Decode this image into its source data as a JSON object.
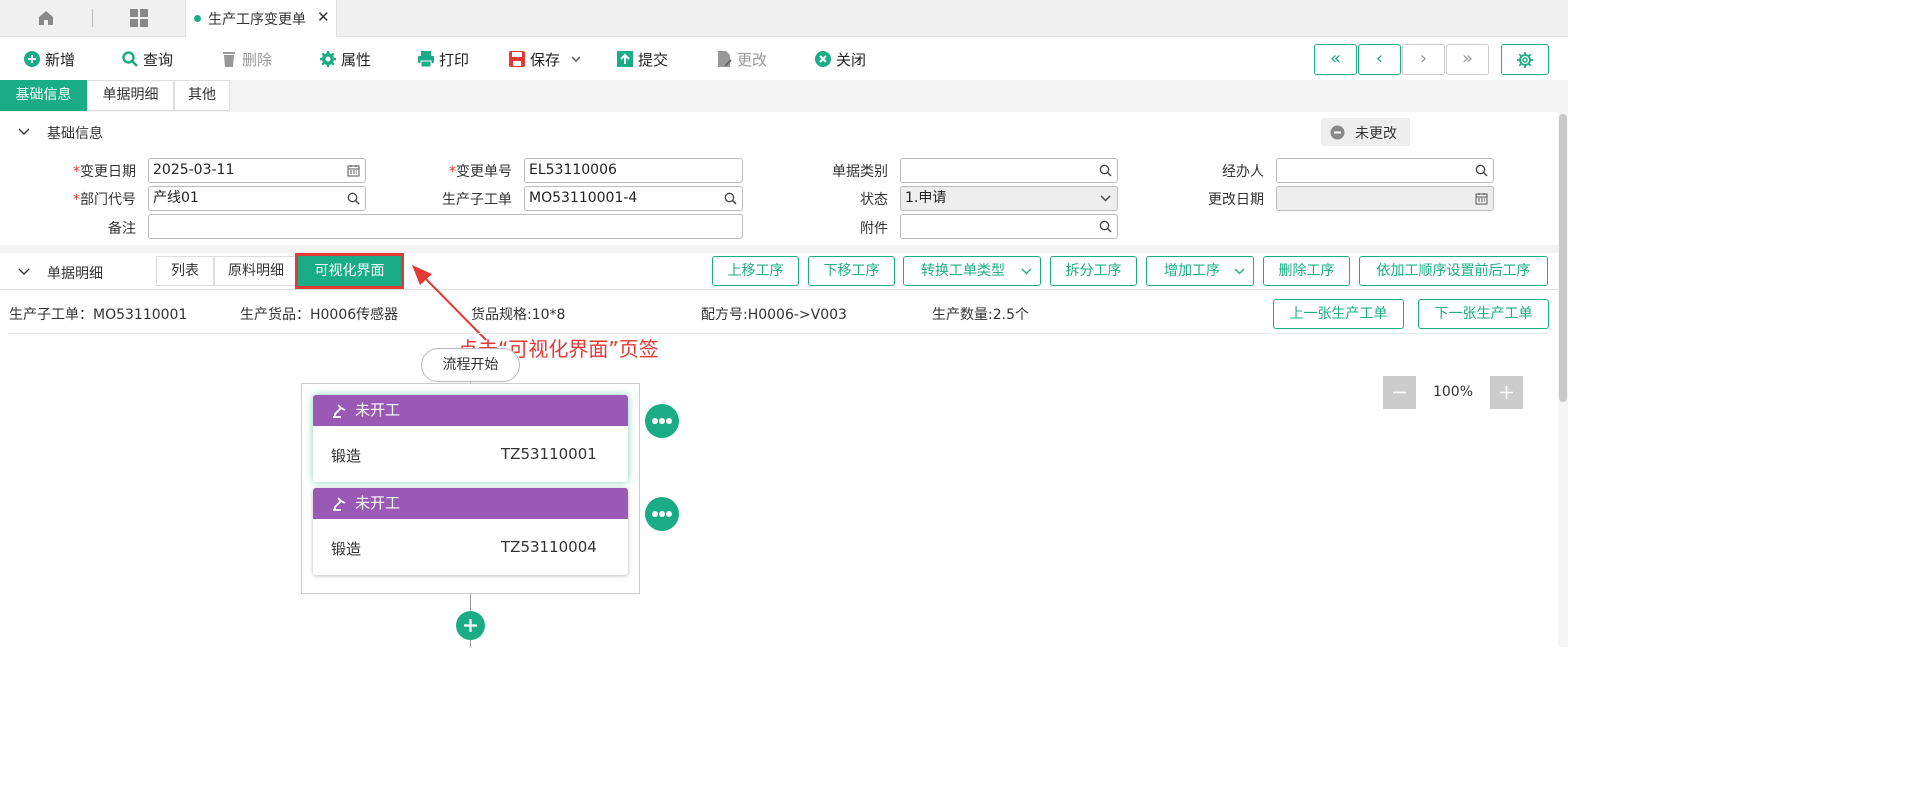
{
  "tabbar": {
    "home_icon": "home-icon",
    "apps_icon": "grid-icon",
    "active_tab": {
      "label": "生产工序变更单",
      "close": "✕"
    }
  },
  "toolbar": {
    "add": "新增",
    "query": "查询",
    "delete": "删除",
    "props": "属性",
    "print": "打印",
    "save": "保存",
    "submit": "提交",
    "modify": "更改",
    "close": "关闭"
  },
  "subtabs": [
    "基础信息",
    "单据明细",
    "其他"
  ],
  "basic": {
    "title": "基础信息",
    "status_badge": "未更改",
    "fields": {
      "change_date_label": "变更日期",
      "change_date": "2025-03-11",
      "change_no_label": "变更单号",
      "change_no": "EL53110006",
      "doc_type_label": "单据类别",
      "doc_type": "",
      "handler_label": "经办人",
      "handler": "",
      "dept_label": "部门代号",
      "dept": "产线01",
      "sub_order_label": "生产子工单",
      "sub_order": "MO53110001-4",
      "status_label": "状态",
      "status": "1.申请",
      "change_date2_label": "更改日期",
      "change_date2": "",
      "remark_label": "备注",
      "remark": "",
      "attach_label": "附件",
      "attach": ""
    }
  },
  "detail": {
    "title": "单据明细",
    "view_tabs": [
      "列表",
      "原料明细",
      "可视化界面"
    ],
    "actions": [
      "上移工序",
      "下移工序",
      "转换工单类型",
      "拆分工序",
      "增加工序",
      "删除工序",
      "依加工顺序设置前后工序"
    ],
    "info": {
      "sub_order": "生产子工单：MO53110001",
      "goods": "生产货品：H0006传感器",
      "spec": "货品规格:10*8",
      "recipe": "配方号:H0006->V003",
      "qty": "生产数量:2.5个"
    },
    "prev_order": "上一张生产工单",
    "next_order": "下一张生产工单",
    "annotation": "点击“可视化界面”页签",
    "flow_start": "流程开始",
    "zoom": "100%",
    "cards": [
      {
        "status": "未开工",
        "process": "锻造",
        "code": "TZ53110001"
      },
      {
        "status": "未开工",
        "process": "锻造",
        "code": "TZ53110004"
      }
    ]
  },
  "colors": {
    "accent": "#1aad85",
    "card_header": "#9b59b6",
    "annotation": "#e53935"
  }
}
